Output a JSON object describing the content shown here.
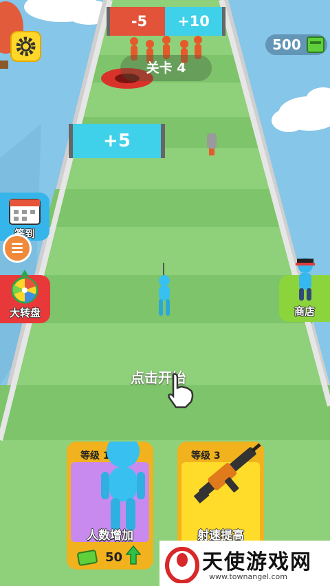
{
  "hud": {
    "money": "500",
    "level_label": "关卡 4"
  },
  "gates": [
    {
      "label": "-5",
      "kind": "minus"
    },
    {
      "label": "+10",
      "kind": "plus"
    },
    {
      "label": "+5",
      "kind": "plus"
    }
  ],
  "side_buttons": {
    "checkin": "签到",
    "wheel": "大转盘",
    "shop": "商店"
  },
  "prompt": "点击开始",
  "upgrades": [
    {
      "level_text": "等级 1",
      "title": "人数增加",
      "cost": "50"
    },
    {
      "level_text": "等级 3",
      "title": "射速提高"
    }
  ],
  "watermark": {
    "name": "天使游戏网",
    "url": "www.townangel.com"
  },
  "colors": {
    "sky": "#86c6e8",
    "track": "#8fd07a",
    "gate_minus": "#e2533a",
    "gate_plus": "#3fd0ea",
    "card_purple": "#c98af0",
    "card_yellow": "#ffdc2a",
    "card_border": "#f2b21d"
  },
  "icons": [
    "settings-gear-icon",
    "cash-icon",
    "calendar-icon",
    "menu-icon",
    "prize-wheel-icon",
    "character-icon",
    "hand-pointer-icon",
    "rifle-icon",
    "upgrade-arrow-icon"
  ]
}
